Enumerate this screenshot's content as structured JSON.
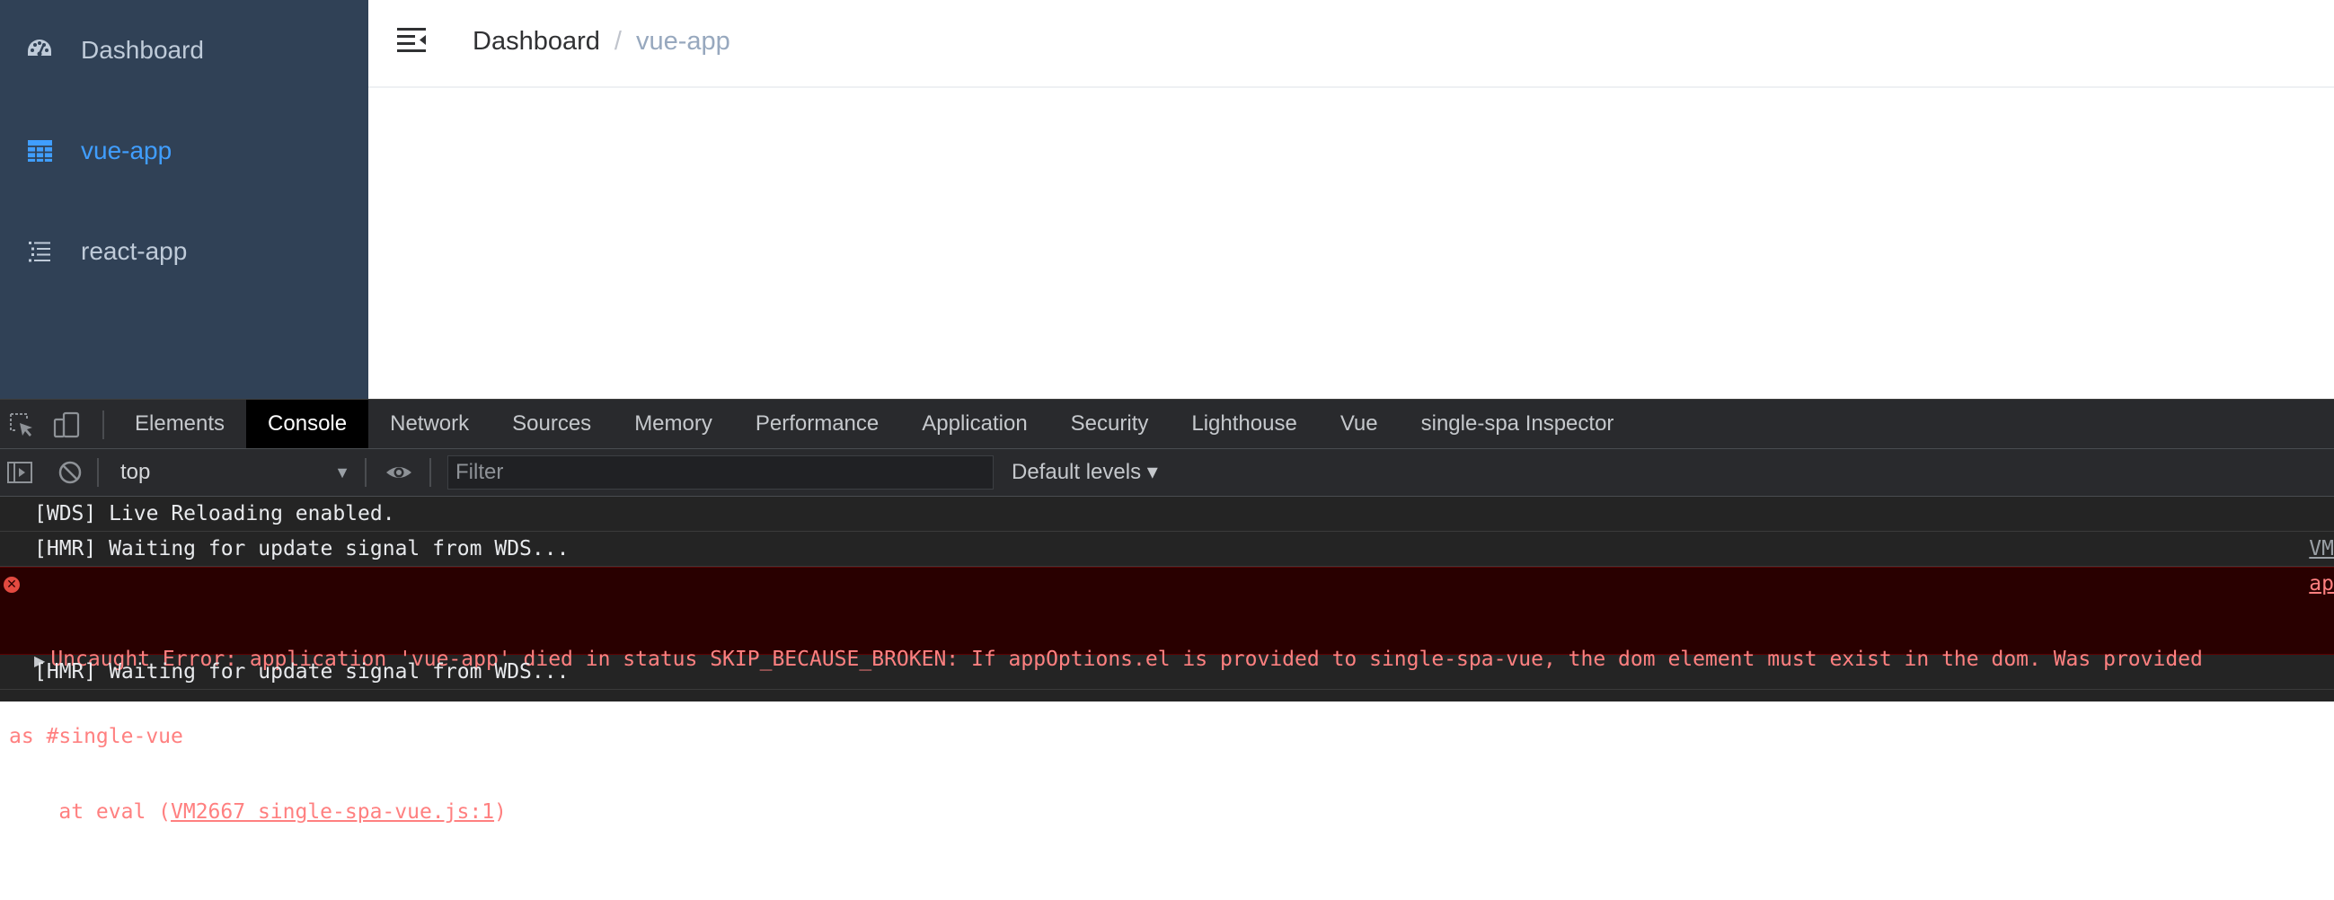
{
  "sidebar": {
    "items": [
      {
        "label": "Dashboard",
        "icon": "dashboard-icon"
      },
      {
        "label": "vue-app",
        "icon": "table-icon",
        "active": true
      },
      {
        "label": "react-app",
        "icon": "list-icon"
      }
    ]
  },
  "breadcrumb": {
    "home": "Dashboard",
    "separator": "/",
    "current": "vue-app"
  },
  "devtools": {
    "tabs": [
      "Elements",
      "Console",
      "Network",
      "Sources",
      "Memory",
      "Performance",
      "Application",
      "Security",
      "Lighthouse",
      "Vue",
      "single-spa Inspector"
    ],
    "active_tab": "Console",
    "context": "top",
    "filter_placeholder": "Filter",
    "levels": "Default levels ▾"
  },
  "console": {
    "line1": "[WDS] Live Reloading enabled.",
    "line2": "[HMR] Waiting for update signal from WDS...",
    "line2_link": "VM",
    "error_line1": "Uncaught Error: application 'vue-app' died in status SKIP_BECAUSE_BROKEN: If appOptions.el is provided to single-spa-vue, the dom element must exist in the dom. Was provided",
    "error_line2": "as #single-vue",
    "error_line3_prefix": "    at eval (",
    "error_source": "VM2667 single-spa-vue.js:1",
    "error_line3_suffix": ")",
    "error_link": "ap",
    "line4": "[HMR] Waiting for update signal from WDS..."
  },
  "colors": {
    "sidebar_bg": "#304156",
    "sidebar_text": "#bfcbd9",
    "active": "#409eff",
    "error_bg": "#290000",
    "error_text": "#ff8080"
  }
}
